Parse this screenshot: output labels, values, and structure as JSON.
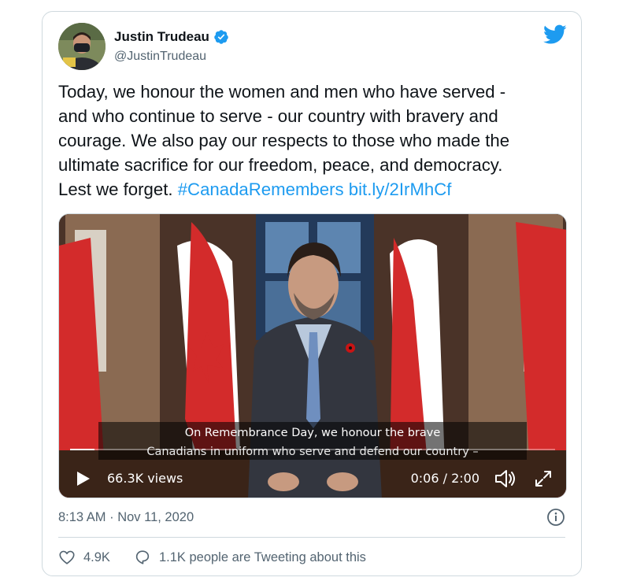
{
  "tweet": {
    "author_name": "Justin Trudeau",
    "author_handle": "@JustinTrudeau",
    "text_plain": "Today, we honour the women and men who have served -\nand who continue to serve - our country with bravery and\ncourage. We also pay our respects to those who made the\nultimate sacrifice for our freedom, peace, and democracy.\nLest we forget. ",
    "hashtag": "#CanadaRemembers",
    "link": "bit.ly/2IrMhCf",
    "timestamp": "8:13 AM · Nov 11, 2020"
  },
  "video": {
    "caption_line1": "On Remembrance Day, we honour the brave",
    "caption_line2": "Canadians in uniform who serve and defend our country –",
    "views": "66.3K views",
    "time": "0:06 / 2:00",
    "progress": 0.05
  },
  "engagement": {
    "likes": "4.9K",
    "conversation": "1.1K people are Tweeting about this"
  },
  "icons": {
    "verified": "verified-badge-icon",
    "brand": "twitter-bird-icon",
    "play": "play-icon",
    "volume": "volume-icon",
    "fullscreen": "fullscreen-icon",
    "info": "info-icon",
    "like": "heart-icon",
    "reply": "speech-bubble-icon"
  },
  "colors": {
    "brand_blue": "#1d9bf0",
    "text_primary": "#0f1419",
    "text_secondary": "#536471",
    "border": "#cfd9de"
  }
}
